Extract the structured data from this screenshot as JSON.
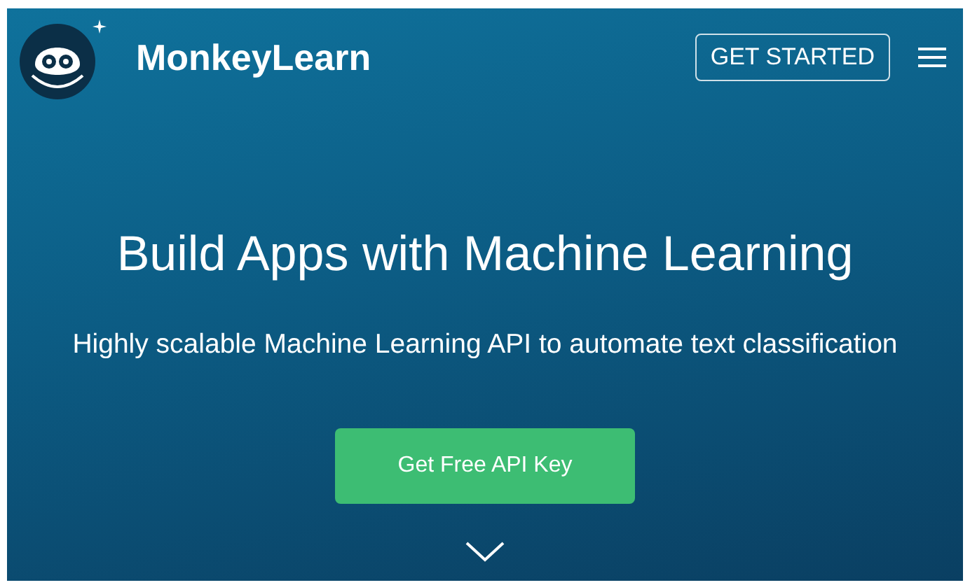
{
  "header": {
    "brand": "MonkeyLearn",
    "cta": "GET STARTED"
  },
  "hero": {
    "title": "Build Apps with Machine Learning",
    "subtitle": "Highly scalable Machine Learning API to automate text classification",
    "button": "Get Free API Key"
  }
}
